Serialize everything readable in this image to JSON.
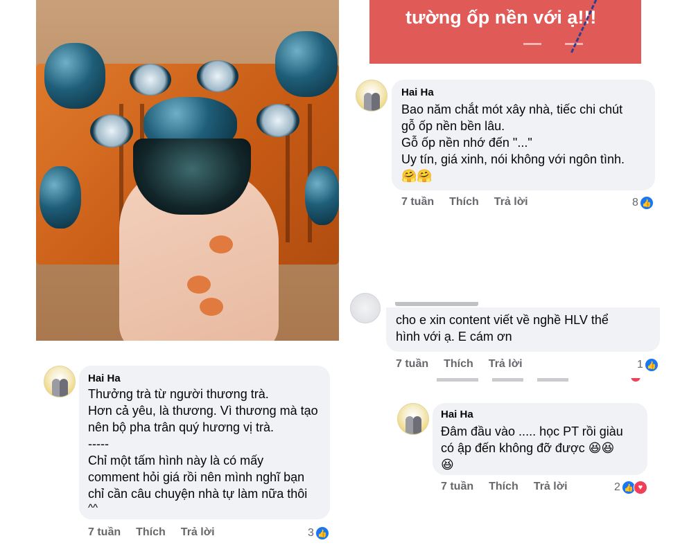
{
  "banner": {
    "text": "tường ốp nền với ạ!!!"
  },
  "comments": [
    {
      "author": "Hai Ha",
      "lines": [
        "Bao năm chắt mót xây nhà, tiếc chi chút",
        "gỗ ốp nền bền lâu.",
        "Gỗ ốp nền nhớ đến \"...\"",
        "Uy tín, giá xinh, nói không với ngôn tình."
      ],
      "emoji": "🤗🤗",
      "time": "7 tuần",
      "like_label": "Thích",
      "reply_label": "Trả lời",
      "reactions": "8"
    },
    {
      "author": "",
      "lines": [
        "cho e xin content viết về nghề HLV thể",
        "hình với ạ. E cám ơn"
      ],
      "time": "7 tuần",
      "like_label": "Thích",
      "reply_label": "Trả lời",
      "reactions": "1"
    },
    {
      "author": "Hai Ha",
      "lines": [
        "Đâm đầu vào ..... học PT rồi giàu",
        "có ập đến không đỡ được 😆😆",
        "😆"
      ],
      "time": "7 tuần",
      "like_label": "Thích",
      "reply_label": "Trả lời",
      "reactions": "2"
    },
    {
      "author": "Hai Ha",
      "lines": [
        "Thưởng trà từ người thương trà.",
        "Hơn cả yêu, là thương. Vì thương mà tạo",
        "nên bộ pha trân quý hương vị trà.",
        "-----",
        "Chỉ một tấm hình này là có mấy",
        "comment hỏi giá rồi nên mình nghĩ bạn",
        "chỉ cần câu chuyện nhà tự làm nữa thôi",
        "^^"
      ],
      "time": "7 tuần",
      "like_label": "Thích",
      "reply_label": "Trả lời",
      "reactions": "3"
    }
  ],
  "icons": {
    "like": "thumbs-up-icon",
    "love": "heart-icon"
  },
  "colors": {
    "bubble": "#f0f2f5",
    "like_blue": "#1877f2",
    "love_red": "#f33e58",
    "banner": "#e05a57"
  }
}
